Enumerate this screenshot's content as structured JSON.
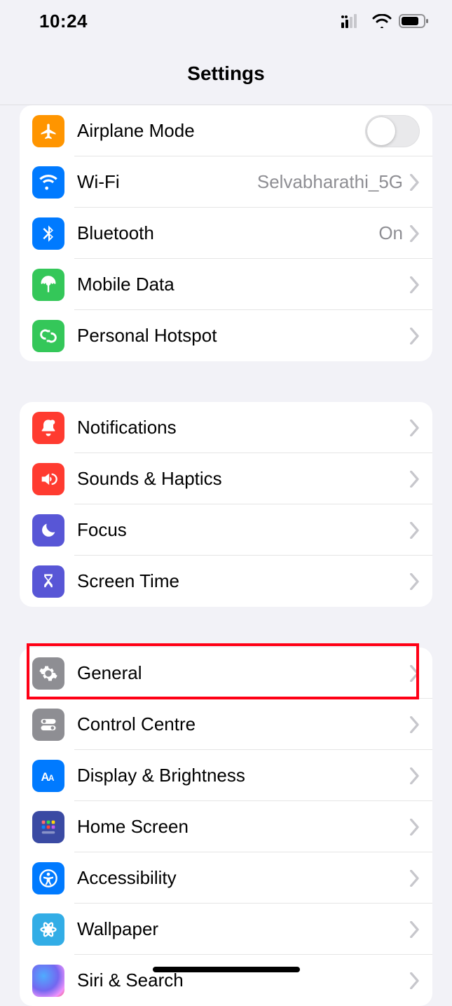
{
  "status": {
    "time": "10:24"
  },
  "title": "Settings",
  "groups": [
    {
      "rows": [
        {
          "id": "airplane",
          "label": "Airplane Mode",
          "toggle": false
        },
        {
          "id": "wifi",
          "label": "Wi-Fi",
          "detail": "Selvabharathi_5G"
        },
        {
          "id": "bluetooth",
          "label": "Bluetooth",
          "detail": "On"
        },
        {
          "id": "mobile-data",
          "label": "Mobile Data"
        },
        {
          "id": "personal-hotspot",
          "label": "Personal Hotspot"
        }
      ]
    },
    {
      "rows": [
        {
          "id": "notifications",
          "label": "Notifications"
        },
        {
          "id": "sounds",
          "label": "Sounds & Haptics"
        },
        {
          "id": "focus",
          "label": "Focus"
        },
        {
          "id": "screen-time",
          "label": "Screen Time"
        }
      ]
    },
    {
      "rows": [
        {
          "id": "general",
          "label": "General"
        },
        {
          "id": "control-centre",
          "label": "Control Centre"
        },
        {
          "id": "display",
          "label": "Display & Brightness"
        },
        {
          "id": "home-screen",
          "label": "Home Screen"
        },
        {
          "id": "accessibility",
          "label": "Accessibility"
        },
        {
          "id": "wallpaper",
          "label": "Wallpaper"
        },
        {
          "id": "siri",
          "label": "Siri & Search"
        }
      ]
    }
  ]
}
